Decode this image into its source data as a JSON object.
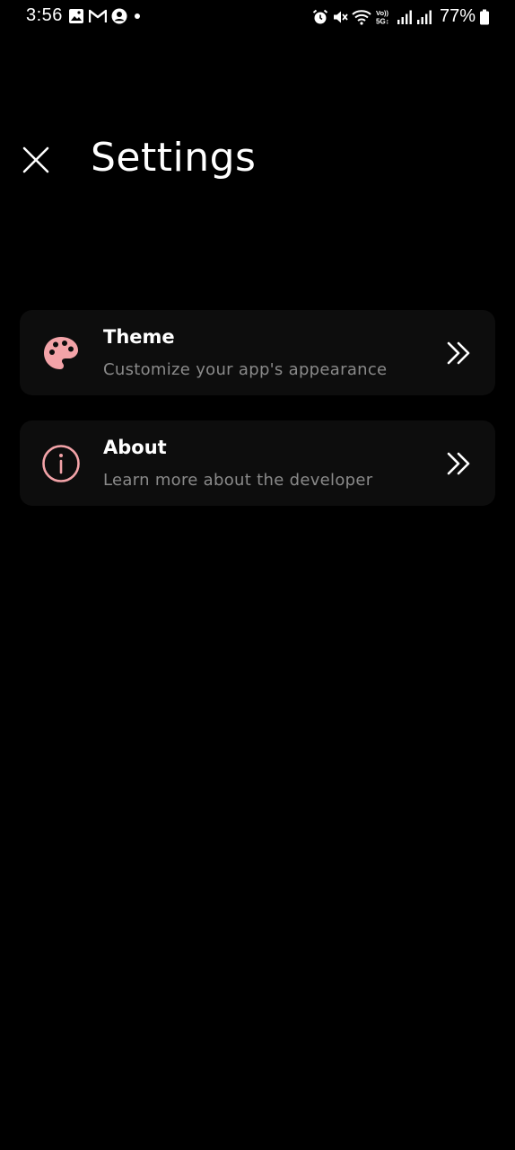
{
  "status_bar": {
    "time": "3:56",
    "battery_percent": "77%",
    "left_icons": [
      "gallery-icon",
      "gmail-icon",
      "account-icon",
      "dot-icon"
    ],
    "right_icons": [
      "alarm-icon",
      "mute-icon",
      "wifi-icon",
      "volte-5g-icon",
      "signal-icon",
      "signal-icon",
      "battery-icon"
    ]
  },
  "header": {
    "title": "Settings",
    "close_icon": "close-icon"
  },
  "settings": {
    "items": [
      {
        "title": "Theme",
        "subtitle": "Customize your app's appearance",
        "icon": "palette-icon"
      },
      {
        "title": "About",
        "subtitle": "Learn more about the developer",
        "icon": "info-icon"
      }
    ]
  },
  "colors": {
    "background": "#000000",
    "card": "#0d0d0d",
    "accent_pink": "#f3a3a8",
    "subtitle_gray": "#8a8a8a",
    "text": "#ffffff"
  }
}
